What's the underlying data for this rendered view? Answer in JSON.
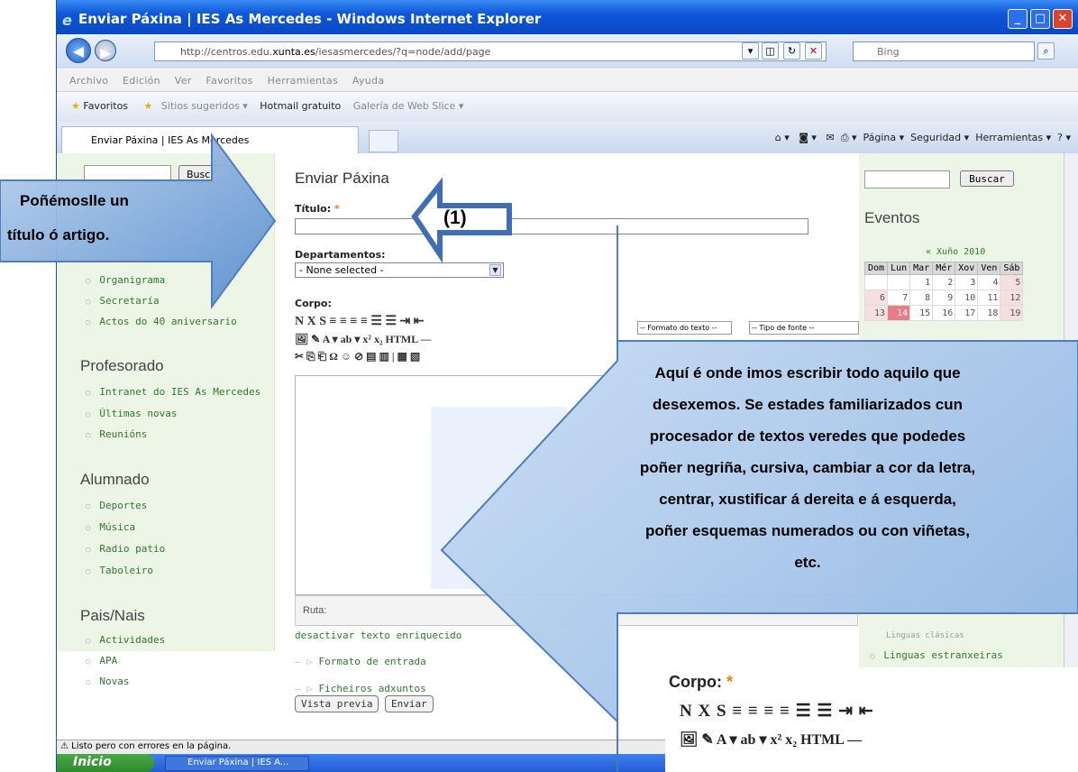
{
  "browser": {
    "title": "Enviar Páxina | IES As Mercedes - Windows Internet Explorer",
    "url_prefix": "http://centros.edu.",
    "url_domain": "xunta.es",
    "url_path": "/iesasmercedes/?q=node/add/page",
    "search_placeholder": "Bing",
    "menu": [
      "Archivo",
      "Edición",
      "Ver",
      "Favoritos",
      "Herramientas",
      "Ayuda"
    ],
    "favorites_label": "Favoritos",
    "fav_items": [
      "Sitios sugeridos ▾",
      "Hotmail gratuito",
      "Galería de Web Slice ▾"
    ],
    "tab_title": "Enviar Páxina | IES As Mercedes",
    "cmd_items": [
      "Página ▾",
      "Seguridad ▾",
      "Herramientas ▾"
    ],
    "status": "Listo pero con errores en la página.",
    "start": "Inicio",
    "task": "Enviar Páxina | IES A..."
  },
  "sidebar": {
    "search_button": "Busc",
    "top_links": [
      "Organigrama",
      "Secretaría",
      "Actos do 40 aniversario"
    ],
    "sections": [
      {
        "title": "Profesorado",
        "links": [
          "Intranet do IES As Mercedes",
          "Últimas novas",
          "Reunións"
        ]
      },
      {
        "title": "Alumnado",
        "links": [
          "Deportes",
          "Música",
          "Radio patio",
          "Taboleiro"
        ]
      },
      {
        "title": "Pais/Nais",
        "links": [
          "Actividades",
          "APA",
          "Novas"
        ]
      }
    ]
  },
  "form": {
    "heading": "Enviar Páxina",
    "title_label": "Título:",
    "required_mark": "*",
    "dept_label": "Departamentos:",
    "dept_value": "- None selected -",
    "body_label": "Corpo:",
    "toolbar_row1": "N  X  S  ≡  ≡  ≡  ≡  ☰  ☰  ⇥  ⇤",
    "toolbar_row2": "🖼  ✎  A ▾  ab ▾  x²  x₂  HTML  —",
    "toolbar_row3": "✂  ⎘  ⎗  Ω  ☺  ⊘  ▤  ▥  |  ▦  ▧",
    "format_select": "-- Formato do texto --",
    "font_select": "-- Tipo de fonte --",
    "path_label": "Ruta:",
    "disable_rich": "desactivar texto enriquecido",
    "input_format": "Formato de entrada",
    "attachments": "Ficheiros adxuntos",
    "preview_button": "Vista previa",
    "submit_button": "Enviar"
  },
  "right": {
    "search_button": "Buscar",
    "events_title": "Eventos",
    "month": "« Xuño 2010",
    "weekdays": [
      "Dom",
      "Lun",
      "Mar",
      "Mér",
      "Xov",
      "Ven",
      "Sáb"
    ],
    "week1": [
      "",
      "",
      "1",
      "2",
      "3",
      "4",
      "5"
    ],
    "week2": [
      "6",
      "7",
      "8",
      "9",
      "10",
      "11",
      "12"
    ],
    "week3": [
      "13",
      "14",
      "15",
      "16",
      "17",
      "18",
      "19"
    ],
    "partial_item": "Linguas clásicas",
    "link": "Linguas estranxeiras"
  },
  "callouts": {
    "left_line1": "Poñémoslle un",
    "left_line2": "título ó artigo.",
    "marker": "(1)",
    "big_line1": "Aquí é onde imos  escribir todo aquilo que",
    "big_line2": "desexemos. Se estades familiarizados cun",
    "big_line3": "procesador de textos veredes que podedes",
    "big_line4": "poñer negriña, cursiva, cambiar a cor da letra,",
    "big_line5": "centrar, xustificar á dereita e á esquerda,",
    "big_line6": "poñer esquemas numerados ou con viñetas,",
    "big_line7": "etc."
  },
  "zoom": {
    "label": "Corpo:",
    "mark": "*",
    "row1": "N  X  S  ≡  ≡  ≡  ≡  ☰  ☰  ⇥  ⇤",
    "row2": "🖼  ✎  A ▾  ab ▾  x²  x₂  HTML  —"
  }
}
